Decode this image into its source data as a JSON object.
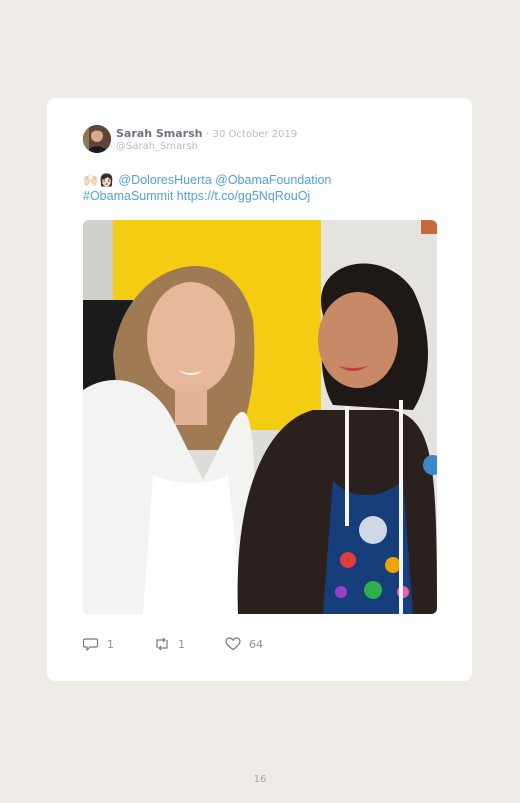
{
  "tweet": {
    "author_name": "Sarah Smarsh",
    "separator": "·",
    "date": "30 October 2019",
    "handle": "@Sarah_Smarsh",
    "emoji": "🙌🏻👩🏻",
    "mention_1": "@DoloresHuerta",
    "mention_2": "@ObamaFoundation",
    "hashtag": "#ObamaSummit",
    "link": "https://t.co/gg5NqRouOj"
  },
  "actions": {
    "replies": "1",
    "retweets": "1",
    "likes": "64"
  },
  "icons": {
    "reply": "reply-icon",
    "retweet": "retweet-icon",
    "like": "heart-icon"
  },
  "colors": {
    "link": "#4fa3d6",
    "background": "#efebe6",
    "card": "#ffffff"
  },
  "page": {
    "number": "16"
  }
}
